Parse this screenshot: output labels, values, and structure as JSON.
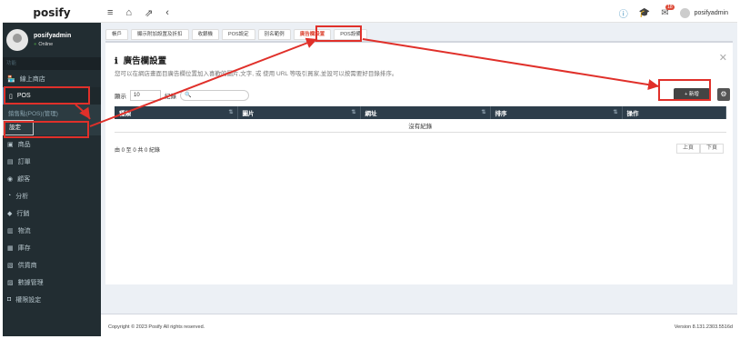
{
  "brand": "posify",
  "topbar": {
    "nav": [
      "≡",
      "⌂",
      "⇗",
      "‹"
    ],
    "notif_count": "18",
    "user": "posifyadmin"
  },
  "user_panel": {
    "name": "posifyadmin",
    "status": "Online"
  },
  "sidebar": {
    "header": "功能",
    "items_top": [
      {
        "icon": "🏪",
        "label": "線上商店"
      },
      {
        "icon": "▯",
        "label": "POS"
      }
    ],
    "sub": [
      {
        "label": "銷售點(POS)(管理)"
      },
      {
        "label": "設定"
      }
    ],
    "items_bottom": [
      {
        "icon": "▣",
        "label": "商品"
      },
      {
        "icon": "▤",
        "label": "訂單"
      },
      {
        "icon": "◉",
        "label": "顧客"
      },
      {
        "icon": "◔",
        "label": "分析"
      },
      {
        "icon": "◆",
        "label": "行銷"
      },
      {
        "icon": "▥",
        "label": "物流"
      },
      {
        "icon": "▦",
        "label": "庫存"
      },
      {
        "icon": "▧",
        "label": "供貨商"
      },
      {
        "icon": "▨",
        "label": "數據管理"
      },
      {
        "icon": "◘",
        "label": "權限設定"
      }
    ]
  },
  "tabs": [
    "帳戶",
    "顯示附加設置及折扣",
    "收銀機",
    "POS設定",
    "別名範例",
    "廣告欄設置",
    "POS設備"
  ],
  "panel": {
    "title": "廣告欄設置",
    "desc": "您可以在網店畫面目廣告欄位置加入喜歡的圖片,文字, 或 使用 URL 等吸引買家,並設可以按需要好目錄排序。",
    "add": "+ 新增",
    "length_label": "顯示",
    "length_value": "10",
    "length_suffix": "紀錄",
    "columns": [
      "種類",
      "圖片",
      "網址",
      "排序",
      "操作"
    ],
    "empty": "沒有紀錄",
    "info": "由 0 至 0 共 0 紀錄",
    "prev": "上頁",
    "next": "下頁"
  },
  "footer": {
    "copyright": "Copyright © 2023 Posify All rights reserved.",
    "version": "Version 8.131.2303.5516d"
  },
  "colors": {
    "sidebar": "#222d32",
    "accent": "#3c8dbc",
    "highlight": "#e0302a"
  }
}
